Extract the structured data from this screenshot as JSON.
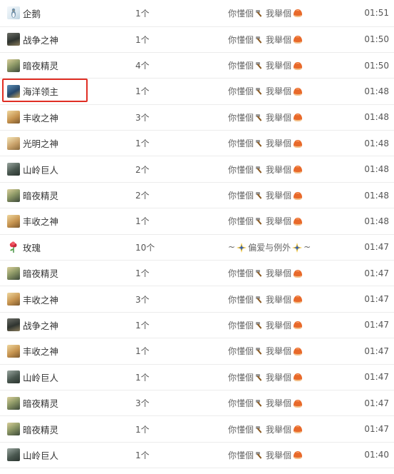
{
  "records": [
    {
      "gift": "企鹅",
      "icon": "penguin-icon",
      "count": "1个",
      "sender_a": "你懂個",
      "sender_b": "我舉個",
      "time": "01:51",
      "style": "normal"
    },
    {
      "gift": "战争之神",
      "icon": "war-god-icon",
      "count": "1个",
      "sender_a": "你懂個",
      "sender_b": "我舉個",
      "time": "01:50",
      "style": "normal"
    },
    {
      "gift": "暗夜精灵",
      "icon": "night-elf-icon",
      "count": "4个",
      "sender_a": "你懂個",
      "sender_b": "我舉個",
      "time": "01:50",
      "style": "normal"
    },
    {
      "gift": "海洋领主",
      "icon": "ocean-lord-icon",
      "count": "1个",
      "sender_a": "你懂個",
      "sender_b": "我舉個",
      "time": "01:48",
      "style": "normal"
    },
    {
      "gift": "丰收之神",
      "icon": "harvest-god-icon",
      "count": "3个",
      "sender_a": "你懂個",
      "sender_b": "我舉個",
      "time": "01:48",
      "style": "normal"
    },
    {
      "gift": "光明之神",
      "icon": "light-god-icon",
      "count": "1个",
      "sender_a": "你懂個",
      "sender_b": "我舉個",
      "time": "01:48",
      "style": "normal"
    },
    {
      "gift": "山岭巨人",
      "icon": "mountain-giant-icon",
      "count": "2个",
      "sender_a": "你懂個",
      "sender_b": "我舉個",
      "time": "01:48",
      "style": "normal"
    },
    {
      "gift": "暗夜精灵",
      "icon": "night-elf-icon",
      "count": "2个",
      "sender_a": "你懂個",
      "sender_b": "我舉個",
      "time": "01:48",
      "style": "normal"
    },
    {
      "gift": "丰收之神",
      "icon": "harvest-god-icon",
      "count": "1个",
      "sender_a": "你懂個",
      "sender_b": "我舉個",
      "time": "01:48",
      "style": "normal"
    },
    {
      "gift": "玫瑰",
      "icon": "rose-icon",
      "count": "10个",
      "sender_a": "~",
      "sender_b": "偏爱与例外",
      "sender_c": "~",
      "time": "01:47",
      "style": "sparkle"
    },
    {
      "gift": "暗夜精灵",
      "icon": "night-elf-icon",
      "count": "1个",
      "sender_a": "你懂個",
      "sender_b": "我舉個",
      "time": "01:47",
      "style": "normal"
    },
    {
      "gift": "丰收之神",
      "icon": "harvest-god-icon",
      "count": "3个",
      "sender_a": "你懂個",
      "sender_b": "我舉個",
      "time": "01:47",
      "style": "normal"
    },
    {
      "gift": "战争之神",
      "icon": "war-god-icon",
      "count": "1个",
      "sender_a": "你懂個",
      "sender_b": "我舉個",
      "time": "01:47",
      "style": "normal"
    },
    {
      "gift": "丰收之神",
      "icon": "harvest-god-icon",
      "count": "1个",
      "sender_a": "你懂個",
      "sender_b": "我舉個",
      "time": "01:47",
      "style": "normal"
    },
    {
      "gift": "山岭巨人",
      "icon": "mountain-giant-icon",
      "count": "1个",
      "sender_a": "你懂個",
      "sender_b": "我舉個",
      "time": "01:47",
      "style": "normal"
    },
    {
      "gift": "暗夜精灵",
      "icon": "night-elf-icon",
      "count": "3个",
      "sender_a": "你懂個",
      "sender_b": "我舉個",
      "time": "01:47",
      "style": "normal"
    },
    {
      "gift": "暗夜精灵",
      "icon": "night-elf-icon",
      "count": "1个",
      "sender_a": "你懂個",
      "sender_b": "我舉個",
      "time": "01:47",
      "style": "normal"
    },
    {
      "gift": "山岭巨人",
      "icon": "mountain-giant-icon",
      "count": "1个",
      "sender_a": "你懂個",
      "sender_b": "我舉個",
      "time": "01:40",
      "style": "normal"
    }
  ],
  "highlighted_gift": "海洋领主",
  "colors": {
    "highlight": "#e02e24",
    "chestnut": "#e8692a",
    "hammer": "#8a5a22",
    "sparkle": "#2f5fb8"
  }
}
